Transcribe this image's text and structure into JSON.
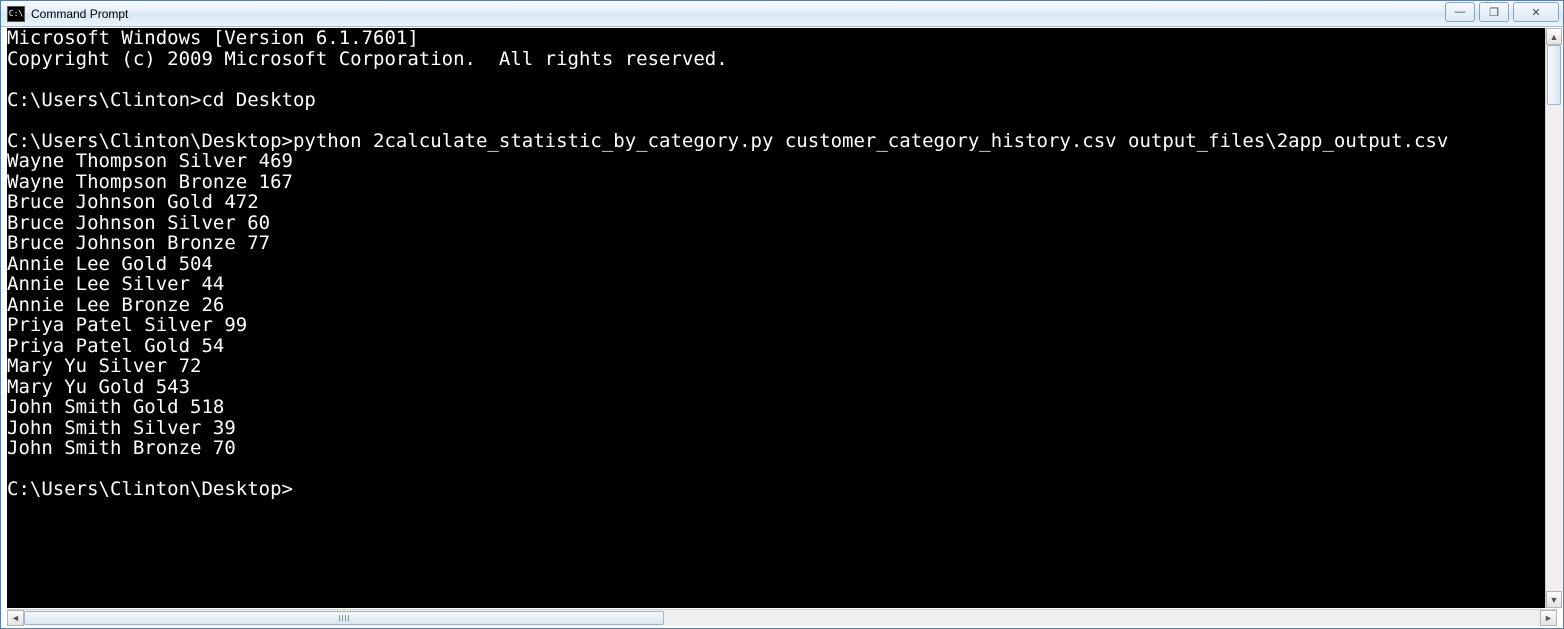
{
  "window": {
    "title": "Command Prompt"
  },
  "terminal": {
    "lines": [
      "Microsoft Windows [Version 6.1.7601]",
      "Copyright (c) 2009 Microsoft Corporation.  All rights reserved.",
      "",
      "C:\\Users\\Clinton>cd Desktop",
      "",
      "C:\\Users\\Clinton\\Desktop>python 2calculate_statistic_by_category.py customer_category_history.csv output_files\\2app_output.csv",
      "Wayne Thompson Silver 469",
      "Wayne Thompson Bronze 167",
      "Bruce Johnson Gold 472",
      "Bruce Johnson Silver 60",
      "Bruce Johnson Bronze 77",
      "Annie Lee Gold 504",
      "Annie Lee Silver 44",
      "Annie Lee Bronze 26",
      "Priya Patel Silver 99",
      "Priya Patel Gold 54",
      "Mary Yu Silver 72",
      "Mary Yu Gold 543",
      "John Smith Gold 518",
      "John Smith Silver 39",
      "John Smith Bronze 70",
      "",
      "C:\\Users\\Clinton\\Desktop>"
    ]
  },
  "controls": {
    "minimize": "—",
    "maximize": "❐",
    "close": "✕",
    "up": "▲",
    "down": "▼",
    "left": "◄",
    "right": "►"
  },
  "icon_label": "C:\\"
}
